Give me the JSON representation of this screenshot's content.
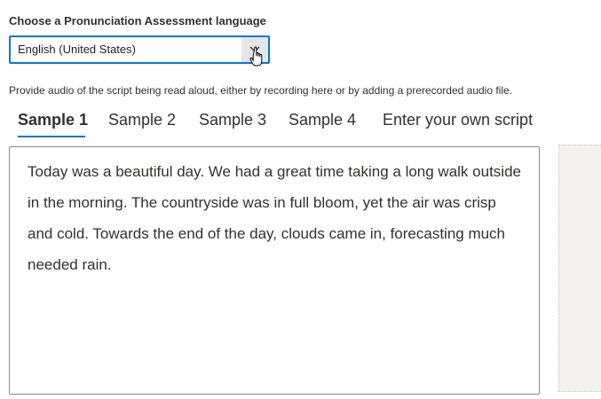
{
  "language": {
    "label": "Choose a Pronunciation Assessment language",
    "selected": "English (United States)"
  },
  "instructions": "Provide audio of the script being read aloud, either by recording here or by adding a prerecorded audio file.",
  "tabs": [
    {
      "label": "Sample 1",
      "active": true
    },
    {
      "label": "Sample 2",
      "active": false
    },
    {
      "label": "Sample 3",
      "active": false
    },
    {
      "label": "Sample 4",
      "active": false
    },
    {
      "label": "Enter your own script",
      "active": false
    }
  ],
  "script": {
    "text": "Today was a beautiful day. We had a great time taking a long walk outside in the morning. The countryside was in full bloom, yet the air was crisp and cold. Towards the end of the day, clouds came in, forecasting much needed rain."
  },
  "colors": {
    "accent": "#0078d4",
    "border": "#8a8886",
    "panel": "#f3f2f1"
  },
  "icons": {
    "dropdown": "chevron-down-icon",
    "pointer": "hand-pointer-cursor-icon"
  }
}
